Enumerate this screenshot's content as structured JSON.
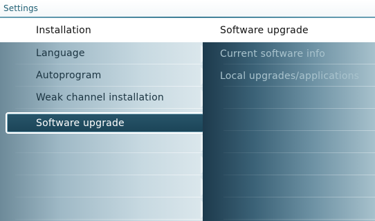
{
  "header": {
    "title": "Settings"
  },
  "columns": {
    "left_title": "Installation",
    "right_title": "Software upgrade"
  },
  "left_menu": {
    "items": [
      {
        "label": "Language"
      },
      {
        "label": "Autoprogram"
      },
      {
        "label": "Weak channel installation"
      },
      {
        "label": "Software upgrade",
        "selected": true
      },
      {
        "label": ""
      },
      {
        "label": ""
      },
      {
        "label": ""
      },
      {
        "label": ""
      }
    ]
  },
  "right_menu": {
    "items": [
      {
        "label": "Current software info"
      },
      {
        "label": "Local upgrades/applications"
      },
      {
        "label": ""
      },
      {
        "label": ""
      },
      {
        "label": ""
      },
      {
        "label": ""
      },
      {
        "label": ""
      },
      {
        "label": ""
      }
    ]
  },
  "colors": {
    "selected_bg": "#1b4457",
    "selected_text": "#ffffff",
    "header_text": "#1f5f73"
  }
}
